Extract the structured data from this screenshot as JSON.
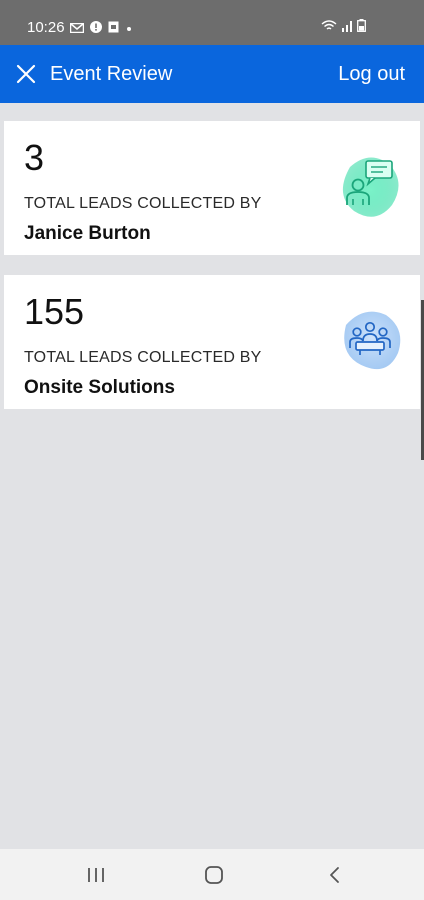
{
  "status_bar": {
    "time": "10:26",
    "left_icons": [
      "mail-icon",
      "alert-icon",
      "sim-icon",
      "dot-icon"
    ],
    "right_icons": [
      "wifi-icon",
      "signal-icon",
      "battery-icon"
    ]
  },
  "app_bar": {
    "title": "Event Review",
    "logout_label": "Log out",
    "background": "#0a66dd"
  },
  "cards": [
    {
      "count": "3",
      "caption": "TOTAL LEADS COLLECTED BY",
      "name": "Janice Burton",
      "icon": "person-chat-icon",
      "accent": "#2fd9a3"
    },
    {
      "count": "155",
      "caption": "TOTAL LEADS COLLECTED BY",
      "name": "Onsite Solutions",
      "icon": "team-meeting-icon",
      "accent": "#4b8fe0"
    }
  ],
  "nav_bar": {
    "buttons": [
      "recents-icon",
      "home-icon",
      "back-icon"
    ]
  }
}
